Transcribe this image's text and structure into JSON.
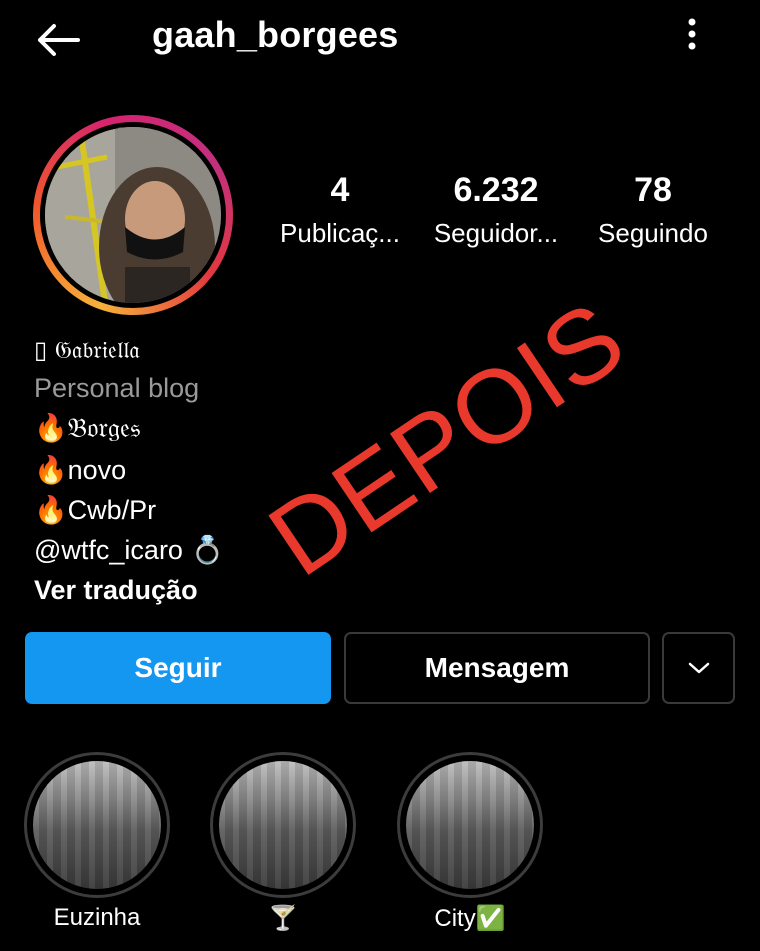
{
  "header": {
    "username": "gaah_borgees",
    "back_icon": "arrow-left-icon",
    "more_icon": "more-vertical-icon"
  },
  "stats": [
    {
      "value": "4",
      "label": "Publicaç..."
    },
    {
      "value": "6.232",
      "label": "Seguidor..."
    },
    {
      "value": "78",
      "label": "Seguindo"
    }
  ],
  "bio": {
    "name": "𝔊𝔞𝔟𝔯𝔦𝔢𝔩𝔩𝔞",
    "name_prefix": "▯",
    "category": "Personal blog",
    "lines": [
      "🔥𝔅𝔬𝔯𝔤𝔢𝔰",
      "🔥novo",
      "🔥Cwb/Pr",
      "@wtfc_icaro 💍"
    ],
    "translate": "Ver tradução"
  },
  "overlay": {
    "text": "DEPOIS",
    "color": "#e8392c"
  },
  "actions": {
    "follow": "Seguir",
    "message": "Mensagem",
    "dropdown_icon": "chevron-down-icon"
  },
  "highlights": [
    {
      "label": "Euzinha"
    },
    {
      "label": "🍸"
    },
    {
      "label": "City✅"
    }
  ],
  "colors": {
    "accent": "#1497f0",
    "background": "#000000",
    "secondary_text": "#9a9a9a"
  }
}
